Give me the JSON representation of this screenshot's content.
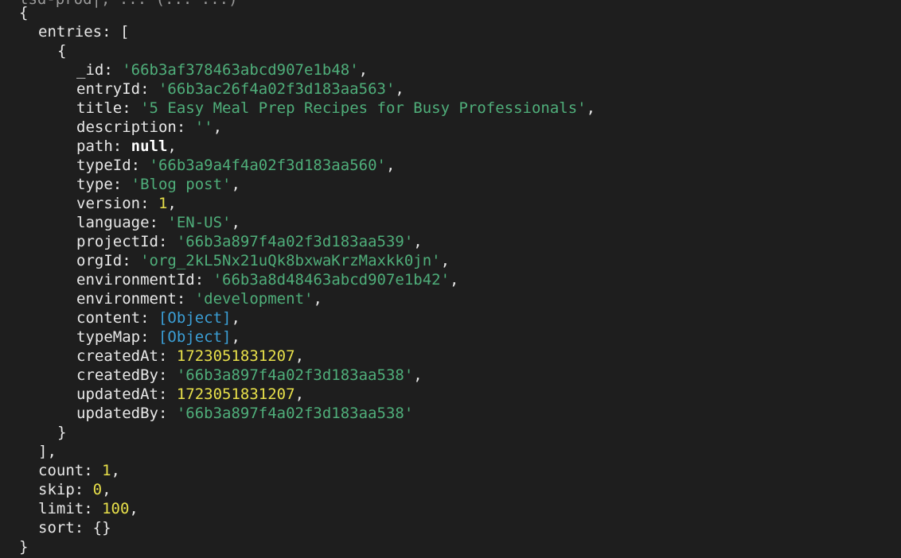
{
  "terminal": {
    "cut_line": "lsd-prod|, ... (... ...)",
    "open_brace": "{",
    "close_brace": "}",
    "entries_key": "entries",
    "entry": {
      "_id": "'66b3af378463abcd907e1b48'",
      "entryId": "'66b3ac26f4a02f3d183aa563'",
      "title": "'5 Easy Meal Prep Recipes for Busy Professionals'",
      "description": "''",
      "path": "null",
      "typeId": "'66b3a9a4f4a02f3d183aa560'",
      "type": "'Blog post'",
      "version": "1",
      "language": "'EN-US'",
      "projectId": "'66b3a897f4a02f3d183aa539'",
      "orgId": "'org_2kL5Nx21uQk8bxwaKrzMaxkk0jn'",
      "environmentId": "'66b3a8d48463abcd907e1b42'",
      "environment": "'development'",
      "content": "[Object]",
      "typeMap": "[Object]",
      "createdAt": "1723051831207",
      "createdBy": "'66b3a897f4a02f3d183aa538'",
      "updatedAt": "1723051831207",
      "updatedBy": "'66b3a897f4a02f3d183aa538'"
    },
    "count": "1",
    "skip": "0",
    "limit": "100",
    "sort": "{}"
  },
  "colors": {
    "background": "#1e1e1e",
    "text": "#e8e8e8",
    "string": "#4fae7a",
    "number": "#e8e04a",
    "object_ref": "#3b9fd6"
  }
}
